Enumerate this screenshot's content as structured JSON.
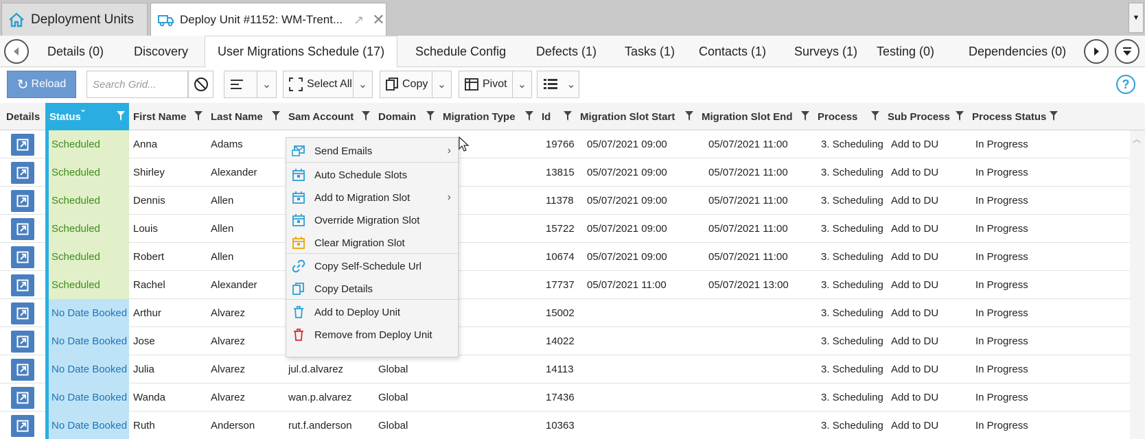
{
  "doc_tabs": [
    {
      "label": "Deployment Units",
      "icon": "home-icon"
    },
    {
      "label": "Deploy Unit #1152: WM-Trent...",
      "icon": "truck-icon"
    }
  ],
  "sub_tabs": [
    {
      "label": "Details (0)"
    },
    {
      "label": "Discovery"
    },
    {
      "label": "User Migrations Schedule (17)"
    },
    {
      "label": "Schedule Config"
    },
    {
      "label": "Defects (1)"
    },
    {
      "label": "Tasks (1)"
    },
    {
      "label": "Contacts (1)"
    },
    {
      "label": "Surveys (1)"
    },
    {
      "label": "Testing (0)"
    },
    {
      "label": "Dependencies (0)"
    }
  ],
  "toolbar": {
    "reload_label": "Reload",
    "search_placeholder": "Search Grid...",
    "select_all_label": "Select All",
    "copy_label": "Copy",
    "pivot_label": "Pivot"
  },
  "columns": [
    "Details",
    "Status",
    "First Name",
    "Last Name",
    "Sam Account",
    "Domain",
    "Migration Type",
    "Id",
    "Migration Slot Start",
    "Migration Slot End",
    "Process",
    "Sub Process",
    "Process Status"
  ],
  "rows": [
    {
      "status": "Scheduled",
      "first": "Anna",
      "last": "Adams",
      "sam": "",
      "domain": "",
      "id": "19766",
      "start": "05/07/2021 09:00",
      "end": "05/07/2021 11:00",
      "process": "3. Scheduling",
      "sub": "Add to DU",
      "pstatus": "In Progress"
    },
    {
      "status": "Scheduled",
      "first": "Shirley",
      "last": "Alexander",
      "sam": "",
      "domain": "",
      "id": "13815",
      "start": "05/07/2021 09:00",
      "end": "05/07/2021 11:00",
      "process": "3. Scheduling",
      "sub": "Add to DU",
      "pstatus": "In Progress"
    },
    {
      "status": "Scheduled",
      "first": "Dennis",
      "last": "Allen",
      "sam": "",
      "domain": "",
      "id": "11378",
      "start": "05/07/2021 09:00",
      "end": "05/07/2021 11:00",
      "process": "3. Scheduling",
      "sub": "Add to DU",
      "pstatus": "In Progress"
    },
    {
      "status": "Scheduled",
      "first": "Louis",
      "last": "Allen",
      "sam": "",
      "domain": "",
      "id": "15722",
      "start": "05/07/2021 09:00",
      "end": "05/07/2021 11:00",
      "process": "3. Scheduling",
      "sub": "Add to DU",
      "pstatus": "In Progress"
    },
    {
      "status": "Scheduled",
      "first": "Robert",
      "last": "Allen",
      "sam": "",
      "domain": "",
      "id": "10674",
      "start": "05/07/2021 09:00",
      "end": "05/07/2021 11:00",
      "process": "3. Scheduling",
      "sub": "Add to DU",
      "pstatus": "In Progress"
    },
    {
      "status": "Scheduled",
      "first": "Rachel",
      "last": "Alexander",
      "sam": "",
      "domain": "",
      "id": "17737",
      "start": "05/07/2021 11:00",
      "end": "05/07/2021 13:00",
      "process": "3. Scheduling",
      "sub": "Add to DU",
      "pstatus": "In Progress"
    },
    {
      "status": "No Date Booked",
      "first": "Arthur",
      "last": "Alvarez",
      "sam": "",
      "domain": "",
      "id": "15002",
      "start": "",
      "end": "",
      "process": "3. Scheduling",
      "sub": "Add to DU",
      "pstatus": "In Progress"
    },
    {
      "status": "No Date Booked",
      "first": "Jose",
      "last": "Alvarez",
      "sam": "",
      "domain": "",
      "id": "14022",
      "start": "",
      "end": "",
      "process": "3. Scheduling",
      "sub": "Add to DU",
      "pstatus": "In Progress"
    },
    {
      "status": "No Date Booked",
      "first": "Julia",
      "last": "Alvarez",
      "sam": "jul.d.alvarez",
      "domain": "Global",
      "id": "14113",
      "start": "",
      "end": "",
      "process": "3. Scheduling",
      "sub": "Add to DU",
      "pstatus": "In Progress"
    },
    {
      "status": "No Date Booked",
      "first": "Wanda",
      "last": "Alvarez",
      "sam": "wan.p.alvarez",
      "domain": "Global",
      "id": "17436",
      "start": "",
      "end": "",
      "process": "3. Scheduling",
      "sub": "Add to DU",
      "pstatus": "In Progress"
    },
    {
      "status": "No Date Booked",
      "first": "Ruth",
      "last": "Anderson",
      "sam": "rut.f.anderson",
      "domain": "Global",
      "id": "10363",
      "start": "",
      "end": "",
      "process": "3. Scheduling",
      "sub": "Add to DU",
      "pstatus": "In Progress"
    }
  ],
  "context_menu": [
    {
      "label": "Send Emails",
      "icon": "email-icon",
      "submenu": true,
      "color": "#2a9fd6"
    },
    {
      "label": "Auto Schedule Slots",
      "icon": "calendar-star-icon",
      "submenu": false,
      "color": "#2a9fd6"
    },
    {
      "label": "Add to Migration Slot",
      "icon": "calendar-add-icon",
      "submenu": true,
      "color": "#2a9fd6"
    },
    {
      "label": "Override Migration Slot",
      "icon": "calendar-edit-icon",
      "submenu": false,
      "color": "#2a9fd6"
    },
    {
      "label": "Clear Migration Slot",
      "icon": "calendar-clear-icon",
      "submenu": false,
      "color": "#f0a500"
    },
    {
      "label": "Copy Self-Schedule Url",
      "icon": "link-icon",
      "submenu": false,
      "color": "#2a9fd6"
    },
    {
      "label": "Copy Details",
      "icon": "copy-icon",
      "submenu": false,
      "color": "#2a9fd6"
    },
    {
      "label": "Add to Deploy Unit",
      "icon": "trash-icon",
      "submenu": false,
      "color": "#2a9fd6"
    },
    {
      "label": "Remove from Deploy Unit",
      "icon": "trash-red-icon",
      "submenu": false,
      "color": "#e0262c"
    }
  ],
  "colors": {
    "status_header": "#2aaee2",
    "scheduled_bg": "#e2f0c9",
    "nodate_bg": "#bfe3f6",
    "reload_bg": "#6a9ad1"
  }
}
